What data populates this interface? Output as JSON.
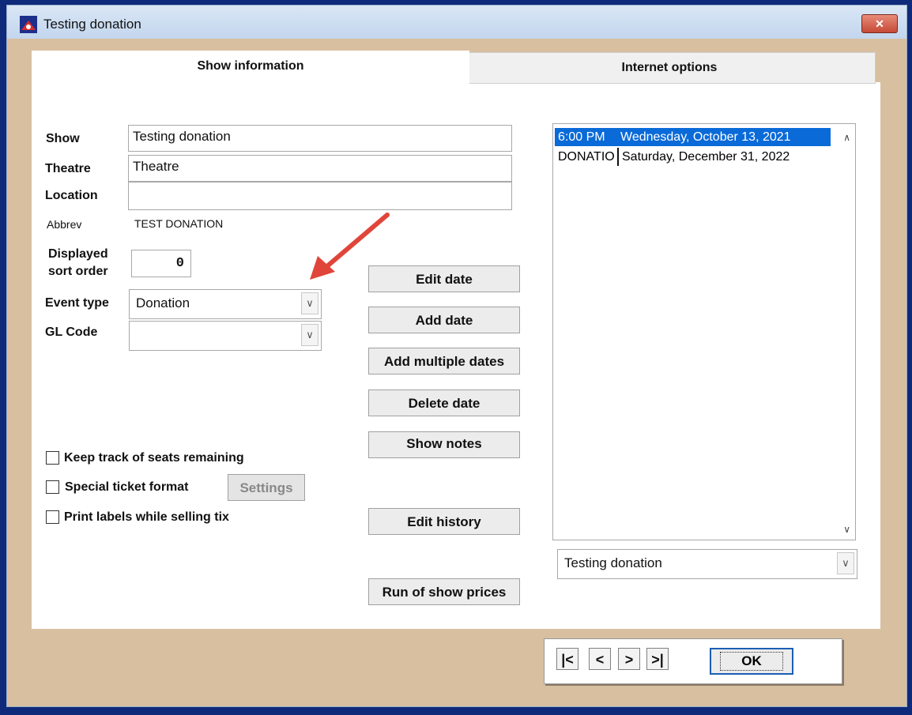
{
  "window": {
    "title": "Testing donation",
    "close_label": "✕"
  },
  "tabs": [
    {
      "label": "Show information",
      "active": true
    },
    {
      "label": "Internet options",
      "active": false
    }
  ],
  "form": {
    "show_label": "Show",
    "show_value": "Testing donation",
    "theatre_label": "Theatre",
    "theatre_value": "Theatre",
    "location_label": "Location",
    "location_value": "",
    "abbrev_label": "Abbrev",
    "abbrev_value": "TEST DONATION",
    "sort_label_line1": "Displayed",
    "sort_label_line2": "sort order",
    "sort_value": "0",
    "event_type_label": "Event type",
    "event_type_value": "Donation",
    "gl_code_label": "GL Code",
    "gl_code_value": ""
  },
  "checkboxes": {
    "keep_track_label": "Keep track of seats remaining",
    "special_format_label": "Special ticket format",
    "settings_button": "Settings",
    "print_labels_label": "Print labels while selling tix"
  },
  "buttons": {
    "edit_date": "Edit date",
    "add_date": "Add date",
    "add_multiple": "Add multiple dates",
    "delete_date": "Delete date",
    "show_notes": "Show notes",
    "edit_history": "Edit history",
    "run_prices": "Run of show prices"
  },
  "date_list": [
    {
      "time": "6:00 PM",
      "date": "Wednesday, October 13, 2021",
      "selected": true
    },
    {
      "time": "DONATIO",
      "date": "Saturday, December 31, 2022",
      "selected": false
    }
  ],
  "show_selector": {
    "value": "Testing donation"
  },
  "nav": {
    "first": "|<",
    "prev": "<",
    "next": ">",
    "last": ">|",
    "ok": "OK"
  },
  "colors": {
    "dialog_bg": "#d8bfa0",
    "selection": "#0a6ad8",
    "annotation_arrow": "#e0453a"
  }
}
